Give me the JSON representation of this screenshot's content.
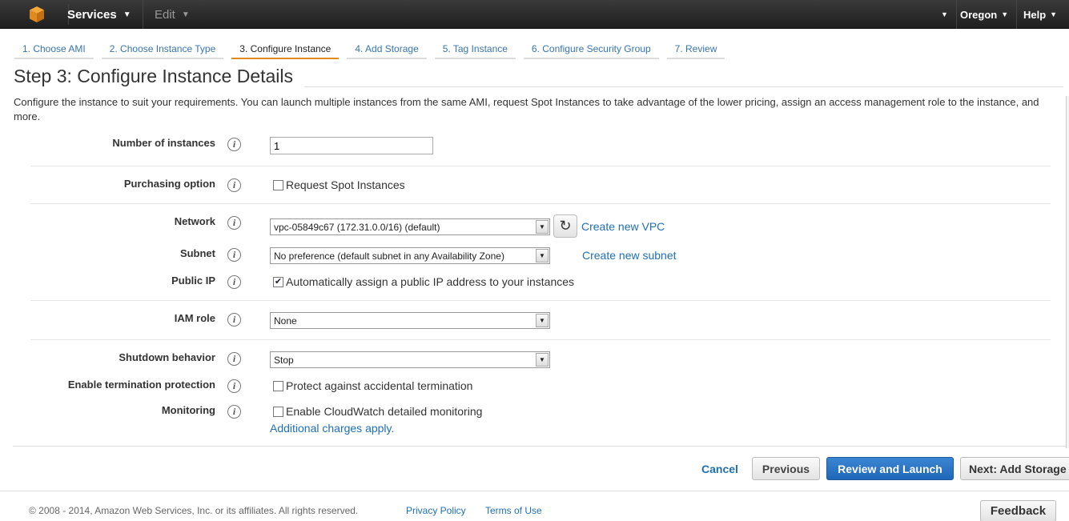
{
  "colors": {
    "accent": "#e08a1e",
    "link": "#1f6fb5",
    "primary_button": "#1f66b7",
    "topbar": "#232f3e"
  },
  "topbar": {
    "logo_icon": "aws-cube-icon",
    "services_label": "Services",
    "edit_label": "Edit",
    "region_label": "Oregon",
    "help_label": "Help"
  },
  "wizard": {
    "tabs": [
      {
        "label": "1. Choose AMI",
        "active": false
      },
      {
        "label": "2. Choose Instance Type",
        "active": false
      },
      {
        "label": "3. Configure Instance",
        "active": true
      },
      {
        "label": "4. Add Storage",
        "active": false
      },
      {
        "label": "5. Tag Instance",
        "active": false
      },
      {
        "label": "6. Configure Security Group",
        "active": false
      },
      {
        "label": "7. Review",
        "active": false
      }
    ]
  },
  "page": {
    "title": "Step 3: Configure Instance Details",
    "description": "Configure the instance to suit your requirements. You can launch multiple instances from the same AMI, request Spot Instances to take advantage of the lower pricing, assign an access management role to the instance, and more."
  },
  "form": {
    "number_of_instances": {
      "label": "Number of instances",
      "value": "1"
    },
    "purchasing_option": {
      "label": "Purchasing option",
      "checkbox_label": "Request Spot Instances",
      "checked": false
    },
    "network": {
      "label": "Network",
      "value": "vpc-05849c67 (172.31.0.0/16) (default)",
      "create_link": "Create new VPC"
    },
    "subnet": {
      "label": "Subnet",
      "value": "No preference (default subnet in any Availability Zone)",
      "create_link": "Create new subnet"
    },
    "public_ip": {
      "label": "Public IP",
      "checkbox_label": "Automatically assign a public IP address to your instances",
      "checked": true
    },
    "iam_role": {
      "label": "IAM role",
      "value": "None"
    },
    "shutdown_behavior": {
      "label": "Shutdown behavior",
      "value": "Stop"
    },
    "termination_protection": {
      "label": "Enable termination protection",
      "checkbox_label": "Protect against accidental termination",
      "checked": false
    },
    "monitoring": {
      "label": "Monitoring",
      "checkbox_label": "Enable CloudWatch detailed monitoring",
      "checked": false,
      "note_link": "Additional charges apply."
    },
    "info_icon": "i"
  },
  "actions": {
    "cancel": "Cancel",
    "previous": "Previous",
    "review_and_launch": "Review and Launch",
    "next": "Next: Add Storage"
  },
  "footer": {
    "copyright": "© 2008 - 2014, Amazon Web Services, Inc. or its affiliates. All rights reserved.",
    "privacy": "Privacy Policy",
    "terms": "Terms of Use",
    "feedback": "Feedback"
  }
}
